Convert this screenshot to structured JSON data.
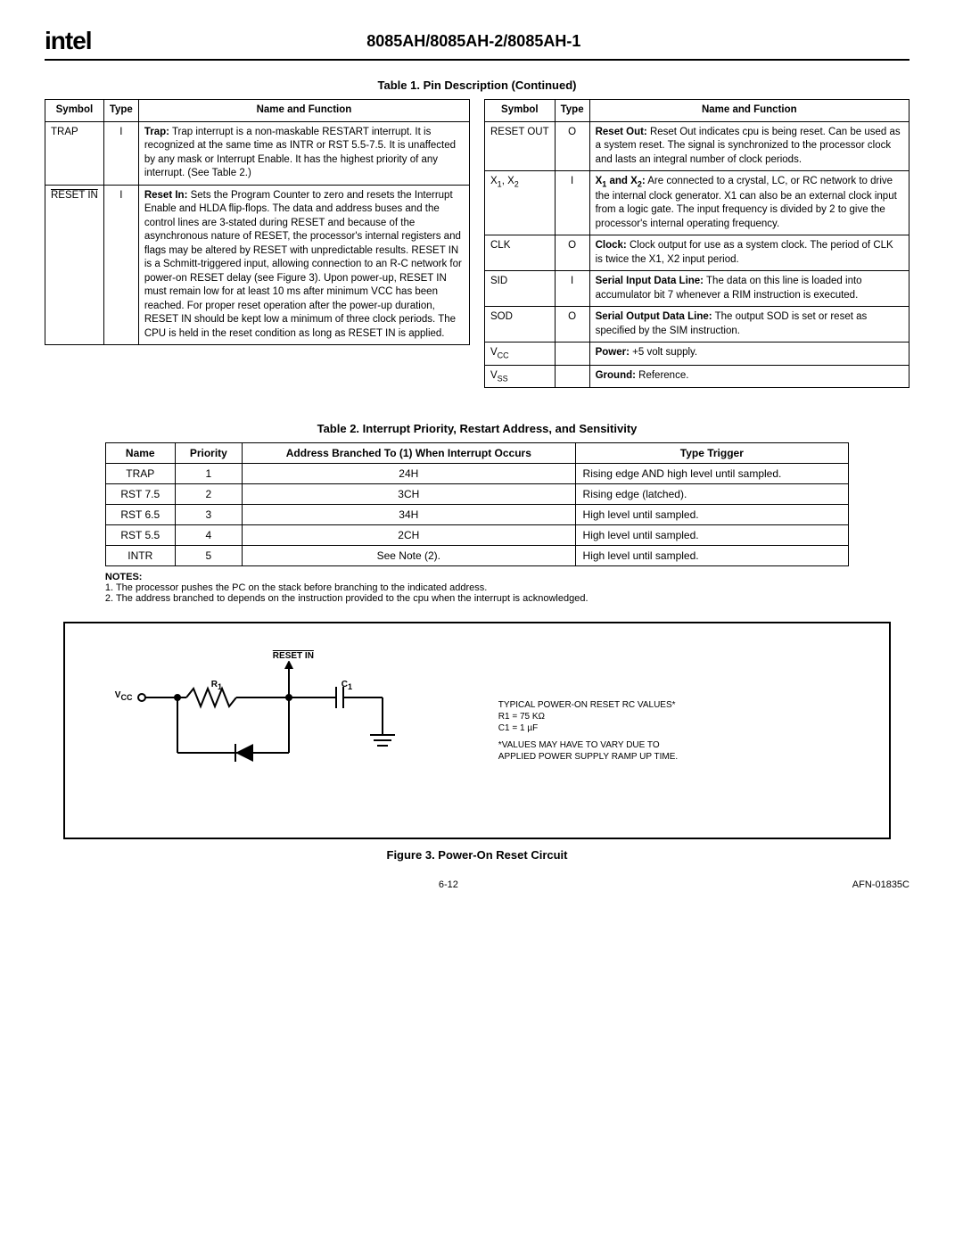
{
  "header": {
    "logo": "intel",
    "title": "8085AH/8085AH-2/8085AH-1"
  },
  "table1": {
    "caption": "Table 1. Pin Description (Continued)",
    "headers": [
      "Symbol",
      "Type",
      "Name and Function"
    ],
    "left": [
      {
        "symbol_html": "TRAP",
        "type": "I",
        "desc_lead": "Trap:",
        "desc": " Trap interrupt is a non-maskable RESTART interrupt. It is recognized at the same time as INTR or RST 5.5-7.5. It is unaffected by any mask or Interrupt Enable. It has the highest priority of any interrupt. (See Table 2.)"
      },
      {
        "symbol_html": "RESET IN",
        "symbol_overline": true,
        "type": "I",
        "desc_lead": "Reset In:",
        "desc": " Sets the Program Counter to zero and resets the Interrupt Enable and HLDA flip-flops. The data and address buses and the control lines are 3-stated during RESET and because of the asynchronous nature of RESET, the processor's internal registers and flags may be altered by RESET with unpredictable results. RESET IN is a Schmitt-triggered input, allowing connection to an R-C network for power-on RESET delay (see Figure 3). Upon power-up, RESET IN must remain low for at least 10 ms after minimum VCC has been reached. For proper reset operation after the power-up duration, RESET IN should be kept low a minimum of three clock periods. The CPU is held in the reset condition as long as RESET IN is applied."
      }
    ],
    "right": [
      {
        "symbol_html": "RESET OUT",
        "type": "O",
        "desc_lead": "Reset Out:",
        "desc": " Reset Out indicates cpu is being reset. Can be used as a system reset. The signal is synchronized to the processor clock and lasts an integral number of clock periods."
      },
      {
        "symbol_html": "X1, X2",
        "type": "I",
        "desc_lead": "X1 and X2:",
        "desc": " Are connected to a crystal, LC, or RC network to drive the internal clock generator. X1 can also be an external clock input from a logic gate. The input frequency is divided by 2 to give the processor's internal operating frequency."
      },
      {
        "symbol_html": "CLK",
        "type": "O",
        "desc_lead": "Clock:",
        "desc": " Clock output for use as a system clock. The period of CLK is twice the X1, X2 input period."
      },
      {
        "symbol_html": "SID",
        "type": "I",
        "desc_lead": "Serial Input Data Line:",
        "desc": " The data on this line is loaded into accumulator bit 7 whenever a RIM instruction is executed."
      },
      {
        "symbol_html": "SOD",
        "type": "O",
        "desc_lead": "Serial Output Data Line:",
        "desc": " The output SOD is set or reset as specified by the SIM instruction."
      },
      {
        "symbol_html": "VCC",
        "type": "",
        "desc_lead": "Power:",
        "desc": " +5 volt supply."
      },
      {
        "symbol_html": "VSS",
        "type": "",
        "desc_lead": "Ground:",
        "desc": " Reference."
      }
    ]
  },
  "table2": {
    "caption": "Table 2. Interrupt Priority, Restart Address, and Sensitivity",
    "headers": [
      "Name",
      "Priority",
      "Address Branched To (1) When Interrupt Occurs",
      "Type Trigger"
    ],
    "rows": [
      {
        "name": "TRAP",
        "priority": "1",
        "addr": "24H",
        "trigger": "Rising edge AND high level until sampled."
      },
      {
        "name": "RST 7.5",
        "priority": "2",
        "addr": "3CH",
        "trigger": "Rising edge (latched)."
      },
      {
        "name": "RST 6.5",
        "priority": "3",
        "addr": "34H",
        "trigger": "High level until sampled."
      },
      {
        "name": "RST 5.5",
        "priority": "4",
        "addr": "2CH",
        "trigger": "High level until sampled."
      },
      {
        "name": "INTR",
        "priority": "5",
        "addr": "See Note (2).",
        "trigger": "High level until sampled."
      }
    ]
  },
  "notes": {
    "title": "NOTES:",
    "items": [
      "1. The processor pushes the PC on the stack before branching to the indicated address.",
      "2. The address branched to depends on the instruction provided to the cpu when the interrupt is acknowledged."
    ]
  },
  "figure3": {
    "reset_label": "RESET IN",
    "r_label": "R1",
    "c_label": "C1",
    "vcc_label": "VCC",
    "side": {
      "l1": "TYPICAL POWER-ON RESET RC VALUES*",
      "l2": "R1 = 75 KΩ",
      "l3": "C1 = 1 µF",
      "l4": "*VALUES MAY HAVE TO VARY DUE TO",
      "l5": "APPLIED POWER SUPPLY RAMP UP TIME."
    },
    "caption": "Figure 3. Power-On Reset Circuit"
  },
  "footer": {
    "page": "6-12",
    "code": "AFN-01835C"
  }
}
